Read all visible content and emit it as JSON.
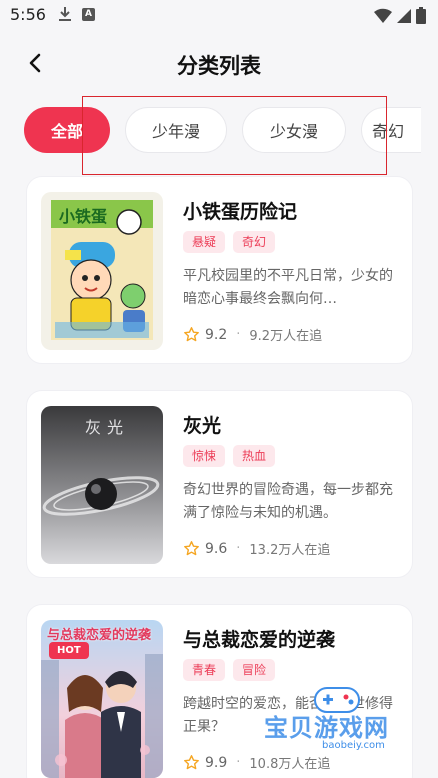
{
  "status_bar": {
    "time": "5:56",
    "indicator": "A"
  },
  "header": {
    "title": "分类列表"
  },
  "categories": [
    {
      "label": "全部",
      "active": true
    },
    {
      "label": "少年漫",
      "active": false
    },
    {
      "label": "少女漫",
      "active": false
    },
    {
      "label": "奇幻",
      "active": false
    }
  ],
  "comics": [
    {
      "title": "小铁蛋历险记",
      "tags": [
        "悬疑",
        "奇幻"
      ],
      "desc": "平凡校园里的不平凡日常，少女的暗恋心事最终会飘向何…",
      "rating": "9.2",
      "readers": "9.2万人在追"
    },
    {
      "title": "灰光",
      "tags": [
        "惊悚",
        "热血"
      ],
      "desc": "奇幻世界的冒险奇遇，每一步都充满了惊险与未知的机遇。",
      "rating": "9.6",
      "readers": "13.2万人在追",
      "cover_text": "灰光"
    },
    {
      "title": "与总裁恋爱的逆袭",
      "tags": [
        "青春",
        "冒险"
      ],
      "desc": "跨越时空的爱恋，能否在现世修得正果？",
      "rating": "9.9",
      "readers": "10.8万人在追",
      "badge": "HOT",
      "cover_text": "与总裁恋爱的逆袭"
    }
  ],
  "watermark": {
    "text": "宝贝游戏网",
    "url": "baobeiy.com"
  },
  "colors": {
    "accent": "#ef3450",
    "tag_bg": "#fde8ec",
    "tag_text": "#ec3d57",
    "star": "#f5a623"
  }
}
